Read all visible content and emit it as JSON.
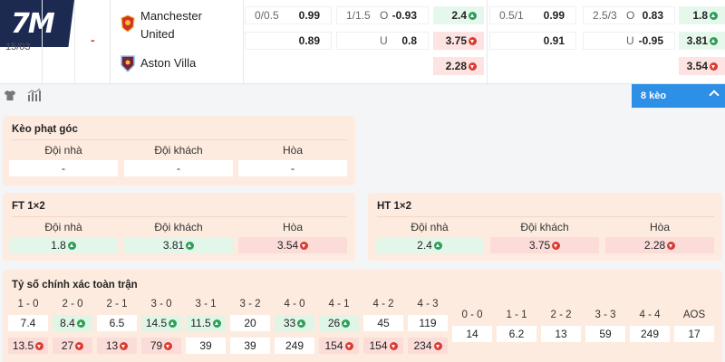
{
  "brand": {
    "logo_text": "7M"
  },
  "match": {
    "date": "15/03",
    "status": "-",
    "home_team": "Manchester United",
    "away_team": "Aston Villa",
    "home_row": [
      {
        "text": "0/0.5",
        "kind": "label"
      },
      {
        "text": "0.99",
        "kind": "bold"
      },
      {
        "text": "1/1.5",
        "kind": "label"
      },
      {
        "text": "O",
        "kind": "label"
      },
      {
        "text": "-0.93",
        "kind": "bold"
      },
      {
        "text": "2.4",
        "kind": "up"
      },
      {
        "text": "0.5/1",
        "kind": "label"
      },
      {
        "text": "0.99",
        "kind": "bold"
      },
      {
        "text": "2.5/3",
        "kind": "label"
      },
      {
        "text": "O",
        "kind": "label"
      },
      {
        "text": "0.83",
        "kind": "bold"
      },
      {
        "text": "1.8",
        "kind": "up"
      }
    ],
    "away_row": [
      {
        "text": "0.89",
        "kind": "bold"
      },
      {
        "text": "U",
        "kind": "label"
      },
      {
        "text": "0.8",
        "kind": "bold"
      },
      {
        "text": "3.75",
        "kind": "down"
      },
      {
        "text": "0.91",
        "kind": "bold"
      },
      {
        "text": "U",
        "kind": "label"
      },
      {
        "text": "-0.95",
        "kind": "bold"
      },
      {
        "text": "3.81",
        "kind": "up"
      }
    ],
    "draw_row": [
      {
        "text": "2.28",
        "kind": "down"
      },
      {
        "text": "3.54",
        "kind": "down"
      }
    ]
  },
  "toolbar": {
    "markets_button": "8 kèo"
  },
  "corner_panel": {
    "title": "Kèo phạt góc",
    "headers": [
      "Đội nhà",
      "Đội khách",
      "Hòa"
    ],
    "values": [
      {
        "text": "-",
        "trend": "none"
      },
      {
        "text": "-",
        "trend": "none"
      },
      {
        "text": "-",
        "trend": "none"
      }
    ]
  },
  "ft_panel": {
    "title": "FT 1×2",
    "headers": [
      "Đội nhà",
      "Đội khách",
      "Hòa"
    ],
    "values": [
      {
        "text": "1.8",
        "trend": "up"
      },
      {
        "text": "3.81",
        "trend": "up"
      },
      {
        "text": "3.54",
        "trend": "down"
      }
    ]
  },
  "ht_panel": {
    "title": "HT 1×2",
    "headers": [
      "Đội nhà",
      "Đội khách",
      "Hòa"
    ],
    "values": [
      {
        "text": "2.4",
        "trend": "up"
      },
      {
        "text": "3.75",
        "trend": "down"
      },
      {
        "text": "2.28",
        "trend": "down"
      }
    ]
  },
  "score_panel": {
    "title": "Tỷ số chính xác toàn trận",
    "home_wins": [
      {
        "score": "1 - 0",
        "home": {
          "text": "7.4",
          "trend": "none"
        },
        "away": {
          "text": "13.5",
          "trend": "down"
        }
      },
      {
        "score": "2 - 0",
        "home": {
          "text": "8.4",
          "trend": "up"
        },
        "away": {
          "text": "27",
          "trend": "down"
        }
      },
      {
        "score": "2 - 1",
        "home": {
          "text": "6.5",
          "trend": "none"
        },
        "away": {
          "text": "13",
          "trend": "down"
        }
      },
      {
        "score": "3 - 0",
        "home": {
          "text": "14.5",
          "trend": "up"
        },
        "away": {
          "text": "79",
          "trend": "down"
        }
      },
      {
        "score": "3 - 1",
        "home": {
          "text": "11.5",
          "trend": "up"
        },
        "away": {
          "text": "39",
          "trend": "none"
        }
      },
      {
        "score": "3 - 2",
        "home": {
          "text": "20",
          "trend": "none"
        },
        "away": {
          "text": "39",
          "trend": "none"
        }
      },
      {
        "score": "4 - 0",
        "home": {
          "text": "33",
          "trend": "up"
        },
        "away": {
          "text": "249",
          "trend": "none"
        }
      },
      {
        "score": "4 - 1",
        "home": {
          "text": "26",
          "trend": "up"
        },
        "away": {
          "text": "154",
          "trend": "down"
        }
      },
      {
        "score": "4 - 2",
        "home": {
          "text": "45",
          "trend": "none"
        },
        "away": {
          "text": "154",
          "trend": "down"
        }
      },
      {
        "score": "4 - 3",
        "home": {
          "text": "119",
          "trend": "none"
        },
        "away": {
          "text": "234",
          "trend": "down"
        }
      }
    ],
    "draws": [
      {
        "score": "0 - 0",
        "value": "14"
      },
      {
        "score": "1 - 1",
        "value": "6.2"
      },
      {
        "score": "2 - 2",
        "value": "13"
      },
      {
        "score": "3 - 3",
        "value": "59"
      },
      {
        "score": "4 - 4",
        "value": "249"
      },
      {
        "score": "AOS",
        "value": "17"
      }
    ]
  }
}
